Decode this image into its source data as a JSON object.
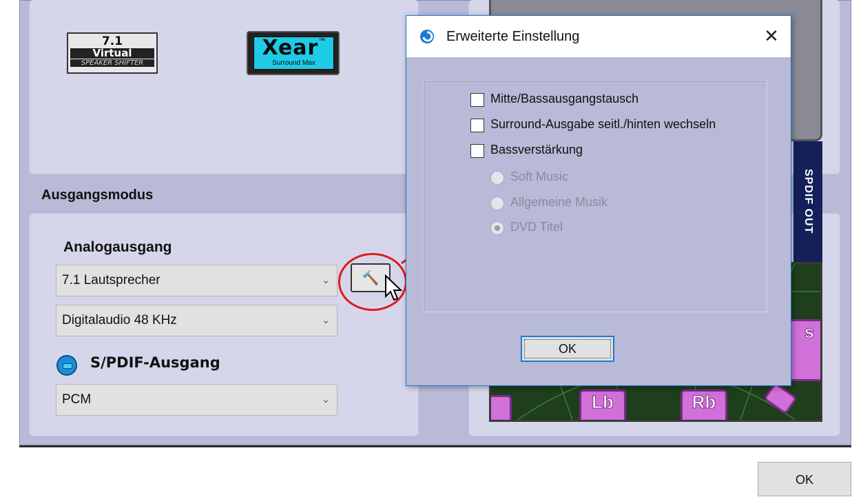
{
  "left_panel": {
    "logos": {
      "virtual_71": {
        "line1": "7.1",
        "line2": "Virtual",
        "line3": "SPEAKER SHIFTER"
      },
      "xear": {
        "word": "Xear",
        "tm": "™",
        "sub": "Surround Max"
      }
    },
    "output_mode_title": "Ausgangsmodus",
    "analog_title": "Analogausgang",
    "analog_select_value": "7.1 Lautsprecher",
    "digital_select_value": "Digitalaudio  48 KHz",
    "spdif_title": "S/PDIF-Ausgang",
    "spdif_select_value": "PCM"
  },
  "right_panel": {
    "spdif_out_label": "SPDIF OUT",
    "speakers": {
      "lb": "Lb",
      "rb": "Rb",
      "rs_partial": "s"
    }
  },
  "dialog": {
    "title": "Erweiterte Einstellung",
    "close_glyph": "✕",
    "checkboxes": [
      {
        "label": "Mitte/Bassausgangstausch",
        "checked": false
      },
      {
        "label": "Surround-Ausgabe seitl./hinten wechseln",
        "checked": false
      },
      {
        "label": "Bassverstärkung",
        "checked": false
      }
    ],
    "radios": [
      {
        "label": "Soft Music",
        "selected": false,
        "enabled": false
      },
      {
        "label": "Allgemeine Musik",
        "selected": false,
        "enabled": false
      },
      {
        "label": "DVD Titel",
        "selected": true,
        "enabled": false
      }
    ],
    "ok_label": "OK"
  },
  "footer": {
    "ok_label": "OK"
  },
  "icons": {
    "wrench": "wrench-icon",
    "chevron": "chevron-down-icon",
    "spdif": "spdif-icon",
    "app": "app-logo-icon",
    "cursor": "mouse-cursor-icon"
  },
  "colors": {
    "annotation_red": "#e01a1a",
    "panel_lavender": "#b9b9d8",
    "dialog_border_blue": "#1a7ad4"
  }
}
